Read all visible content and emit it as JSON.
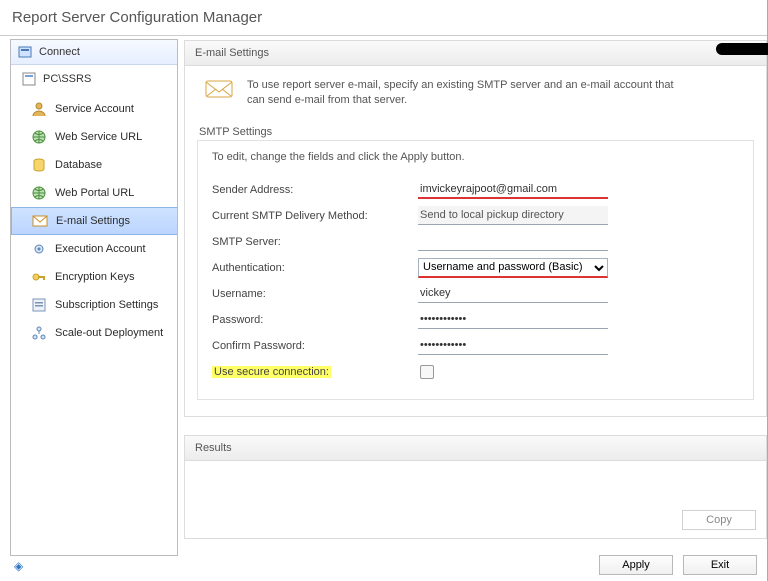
{
  "window": {
    "title": "Report Server Configuration Manager"
  },
  "sidebar": {
    "connect_label": "Connect",
    "node_label": "PC\\SSRS",
    "items": [
      {
        "label": "Service Account",
        "icon": "user-icon"
      },
      {
        "label": "Web Service URL",
        "icon": "globe-icon"
      },
      {
        "label": "Database",
        "icon": "database-icon"
      },
      {
        "label": "Web Portal URL",
        "icon": "globe-icon"
      },
      {
        "label": "E-mail Settings",
        "icon": "mail-icon",
        "selected": true
      },
      {
        "label": "Execution Account",
        "icon": "gear-icon"
      },
      {
        "label": "Encryption Keys",
        "icon": "key-icon"
      },
      {
        "label": "Subscription Settings",
        "icon": "subscription-icon"
      },
      {
        "label": "Scale-out Deployment",
        "icon": "scale-icon"
      }
    ]
  },
  "panel": {
    "header": "E-mail Settings",
    "intro": "To use report server e-mail, specify an existing SMTP server and an e-mail account that can send e-mail from that server.",
    "fieldset_title": "SMTP Settings",
    "fieldset_note": "To edit, change the fields and click the Apply button.",
    "labels": {
      "sender": "Sender Address:",
      "delivery": "Current SMTP Delivery Method:",
      "smtp": "SMTP Server:",
      "auth": "Authentication:",
      "user": "Username:",
      "pass": "Password:",
      "confirm": "Confirm Password:",
      "secure": "Use secure connection:"
    },
    "values": {
      "sender": "imvickeyrajpoot@gmail.com",
      "delivery": "Send to local pickup directory",
      "smtp": "",
      "auth": "Username and password (Basic)",
      "user": "vickey",
      "pass": "••••••••••••",
      "confirm": "••••••••••••",
      "secure_checked": false
    }
  },
  "results": {
    "header": "Results",
    "copy_label": "Copy"
  },
  "footer": {
    "apply_label": "Apply",
    "exit_label": "Exit"
  }
}
